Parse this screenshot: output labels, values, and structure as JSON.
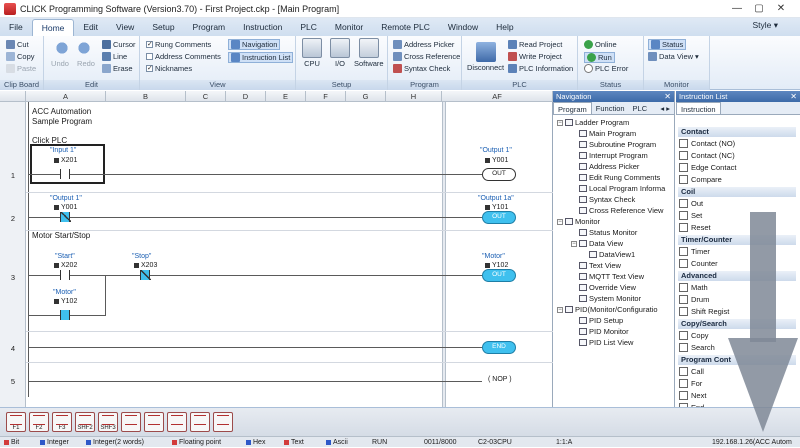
{
  "window": {
    "title": "CLICK Programming Software (Version3.70) - First Project.ckp - [Main Program]"
  },
  "menu": {
    "items": [
      "File",
      "Home",
      "Edit",
      "View",
      "Setup",
      "Program",
      "Instruction",
      "PLC",
      "Monitor",
      "Remote PLC",
      "Window",
      "Help"
    ],
    "active": "Home",
    "style_label": "Style"
  },
  "ribbon": {
    "clipboard": {
      "caption": "Clip Board",
      "cut": "Cut",
      "copy": "Copy",
      "paste": "Paste"
    },
    "edit": {
      "caption": "Edit",
      "undo": "Undo",
      "redo": "Redo",
      "cursor": "Cursor",
      "line": "Line",
      "erase": "Erase"
    },
    "view": {
      "caption": "View",
      "rung_comments": "Rung Comments",
      "address_comments": "Address Comments",
      "nicknames": "Nicknames",
      "navigation": "Navigation",
      "instruction_list": "Instruction List"
    },
    "setup": {
      "caption": "Setup",
      "cpu": "CPU",
      "io": "I/O",
      "software": "Software"
    },
    "program": {
      "caption": "Program",
      "address_picker": "Address Picker",
      "cross_reference": "Cross Reference",
      "syntax_check": "Syntax Check"
    },
    "plc": {
      "caption": "PLC",
      "disconnect": "Disconnect",
      "read_project": "Read Project",
      "write_project": "Write Project",
      "plc_information": "PLC Information"
    },
    "status": {
      "caption": "Status",
      "online": "Online",
      "run": "Run",
      "plc_error": "PLC Error"
    },
    "monitor": {
      "caption": "Monitor",
      "status": "Status",
      "data_view": "Data View"
    }
  },
  "ladder": {
    "columns": [
      "A",
      "B",
      "C",
      "D",
      "E",
      "F",
      "G",
      "H",
      "AF"
    ],
    "header_text": [
      "ACC Automation",
      "Sample Program"
    ],
    "rungs": [
      {
        "number": "1",
        "comment": "Click PLC",
        "contact": {
          "nickname": "\"Input 1\"",
          "address": "X201"
        },
        "coil": {
          "nickname": "\"Output 1\"",
          "address": "Y001",
          "label": "OUT"
        }
      },
      {
        "number": "2",
        "contact": {
          "nickname": "\"Output 1\"",
          "address": "Y001"
        },
        "coil": {
          "nickname": "\"Output 1a\"",
          "address": "Y101",
          "label": "OUT"
        }
      },
      {
        "number": "3",
        "comment": "Motor Start/Stop",
        "contact_start": {
          "nickname": "\"Start\"",
          "address": "X202"
        },
        "contact_stop": {
          "nickname": "\"Stop\"",
          "address": "X203"
        },
        "contact_seal": {
          "nickname": "\"Motor\"",
          "address": "Y102"
        },
        "coil": {
          "nickname": "\"Motor\"",
          "address": "Y102",
          "label": "OUT"
        }
      },
      {
        "number": "4",
        "end_label": "END"
      },
      {
        "number": "5",
        "nop_label": "NOP"
      }
    ]
  },
  "navigation": {
    "title": "Navigation",
    "tabs": [
      "Program",
      "Function",
      "PLC"
    ],
    "tree": [
      {
        "label": "Ladder Program",
        "level": 0
      },
      {
        "label": "Main Program",
        "level": 1
      },
      {
        "label": "Subroutine Program",
        "level": 1
      },
      {
        "label": "Interrupt Program",
        "level": 1
      },
      {
        "label": "Address Picker",
        "level": 1
      },
      {
        "label": "Edit Rung Comments",
        "level": 1
      },
      {
        "label": "Local Program Informa",
        "level": 1
      },
      {
        "label": "Syntax Check",
        "level": 1
      },
      {
        "label": "Cross Reference View",
        "level": 1
      },
      {
        "label": "Monitor",
        "level": 0
      },
      {
        "label": "Status Monitor",
        "level": 1
      },
      {
        "label": "Data View",
        "level": 1
      },
      {
        "label": "DataView1",
        "level": 2
      },
      {
        "label": "Text View",
        "level": 1
      },
      {
        "label": "MQTT Text View",
        "level": 1
      },
      {
        "label": "Override View",
        "level": 1
      },
      {
        "label": "System Monitor",
        "level": 1
      },
      {
        "label": "PID(Monitor/Configuratio",
        "level": 0
      },
      {
        "label": "PID Setup",
        "level": 1
      },
      {
        "label": "PID Monitor",
        "level": 1
      },
      {
        "label": "PID List View",
        "level": 1
      }
    ]
  },
  "instruction_list": {
    "title": "Instruction List",
    "tab": "Instruction",
    "categories": [
      {
        "name": "Contact",
        "items": [
          "Contact (NO)",
          "Contact (NC)",
          "Edge Contact",
          "Compare"
        ]
      },
      {
        "name": "Coil",
        "items": [
          "Out",
          "Set",
          "Reset"
        ]
      },
      {
        "name": "Timer/Counter",
        "items": [
          "Timer",
          "Counter"
        ]
      },
      {
        "name": "Advanced",
        "items": [
          "Math",
          "Drum",
          "Shift Regist"
        ]
      },
      {
        "name": "Copy/Search",
        "items": [
          "Copy",
          "Search"
        ]
      },
      {
        "name": "Program Cont",
        "items": [
          "Call",
          "For",
          "Next",
          "End"
        ]
      }
    ]
  },
  "function_keys": [
    "F1",
    "F2",
    "F3",
    "SHF2",
    "SHF3",
    "",
    "",
    "",
    "",
    "",
    ""
  ],
  "statusbar": {
    "bit": "Bit",
    "integer": "Integer",
    "integer2": "Integer(2 words)",
    "float": "Floating point",
    "hex": "Hex",
    "text": "Text",
    "ascii": "Ascii",
    "mode": "RUN",
    "memory": "0011/8000",
    "cpu": "C2-03CPU",
    "ratio": "1:1:A",
    "connection": "192.168.1.26(ACC Autom"
  },
  "colors": {
    "accent": "#3fc0ee",
    "menu_bg": "#dfe9f5",
    "panel_header": "#3c6aa8",
    "arrow": "#7f8896"
  }
}
